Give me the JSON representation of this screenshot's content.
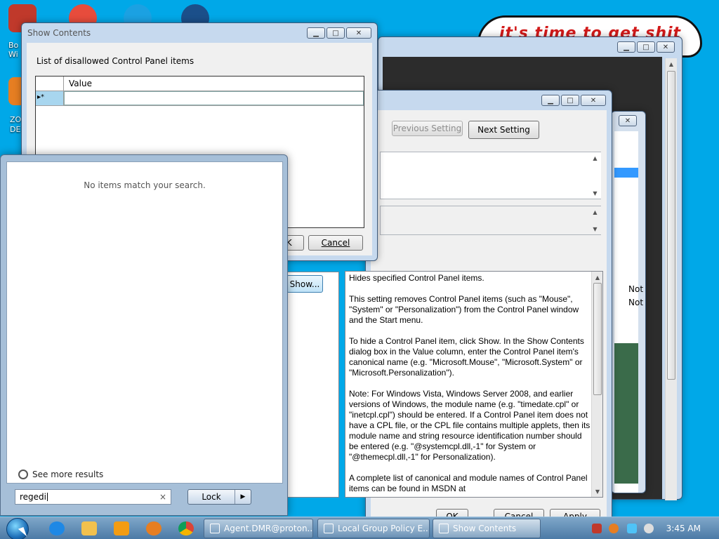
{
  "desktop": {
    "icons": [
      {
        "label": "Bo\nWin",
        "color": "#c0392b"
      },
      {
        "label": "ZO\nDE",
        "color": "#e67e22"
      }
    ],
    "wallpaper_text": "it's time to get shit"
  },
  "show_contents": {
    "title": "Show Contents",
    "caption": "List of disallowed Control Panel items",
    "column_header": "Value",
    "new_row_marker": "▸*",
    "ok_label": "OK",
    "cancel_label": "Cancel"
  },
  "policy_editor": {
    "prev_label": "Previous Setting",
    "next_label": "Next Setting",
    "show_label": "Show...",
    "ok_label": "OK",
    "cancel_label": "Cancel",
    "apply_label": "Apply",
    "help_paragraphs": [
      "Hides specified Control Panel items.",
      "This setting removes Control Panel items (such as \"Mouse\", \"System\" or \"Personalization\") from the Control Panel window and the Start menu.",
      "To hide a Control Panel item, click Show. In the Show Contents dialog box in the Value column, enter the Control Panel item's canonical name (e.g. \"Microsoft.Mouse\", \"Microsoft.System\" or \"Microsoft.Personalization\").",
      "Note: For Windows Vista, Windows Server 2008, and earlier versions of Windows, the module name (e.g. \"timedate.cpl\" or \"inetcpl.cpl\") should be entered. If a Control Panel item does not have a CPL file, or the CPL file contains multiple applets, then its module name and string resource identification number should be entered (e.g. \"@systemcpl.dll,-1\" for System or \"@themecpl.dll,-1\" for Personalization).",
      "A complete list of canonical and module names of Control Panel items can be found in MSDN at"
    ]
  },
  "background_window": {
    "status_items": [
      "Not",
      "Not"
    ]
  },
  "start_menu": {
    "no_results": "No items match your search.",
    "see_more": "See more results",
    "search_value": "regedi",
    "clear_glyph": "×",
    "lock_label": "Lock",
    "arrow_glyph": "▶"
  },
  "taskbar": {
    "tasks": [
      {
        "label": "Agent.DMR@proton..."
      },
      {
        "label": "Local Group Policy E..."
      },
      {
        "label": "Show Contents"
      }
    ],
    "clock": "3:45 AM"
  },
  "window_controls": {
    "min": "▁",
    "max": "□",
    "close": "✕"
  }
}
